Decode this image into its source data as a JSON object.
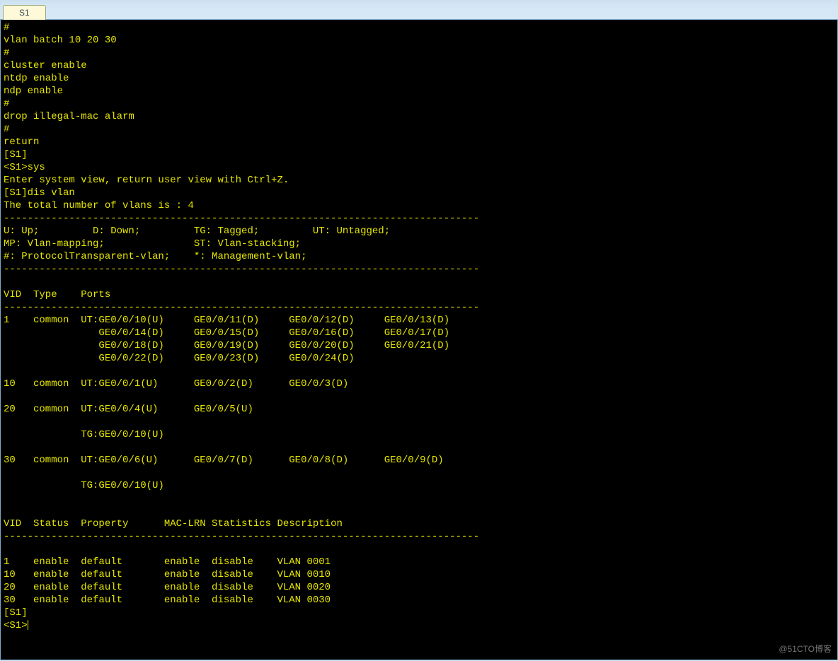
{
  "tab": {
    "label": "S1"
  },
  "terminal": {
    "lines": [
      "#",
      "vlan batch 10 20 30",
      "#",
      "cluster enable",
      "ntdp enable",
      "ndp enable",
      "#",
      "drop illegal-mac alarm",
      "#",
      "return",
      "[S1]",
      "<S1>sys",
      "Enter system view, return user view with Ctrl+Z.",
      "[S1]dis vlan",
      "The total number of vlans is : 4",
      "--------------------------------------------------------------------------------",
      "U: Up;         D: Down;         TG: Tagged;         UT: Untagged;",
      "MP: Vlan-mapping;               ST: Vlan-stacking;",
      "#: ProtocolTransparent-vlan;    *: Management-vlan;",
      "--------------------------------------------------------------------------------",
      "",
      "VID  Type    Ports",
      "--------------------------------------------------------------------------------",
      "1    common  UT:GE0/0/10(U)     GE0/0/11(D)     GE0/0/12(D)     GE0/0/13(D)",
      "                GE0/0/14(D)     GE0/0/15(D)     GE0/0/16(D)     GE0/0/17(D)",
      "                GE0/0/18(D)     GE0/0/19(D)     GE0/0/20(D)     GE0/0/21(D)",
      "                GE0/0/22(D)     GE0/0/23(D)     GE0/0/24(D)",
      "",
      "10   common  UT:GE0/0/1(U)      GE0/0/2(D)      GE0/0/3(D)",
      "",
      "20   common  UT:GE0/0/4(U)      GE0/0/5(U)",
      "",
      "             TG:GE0/0/10(U)",
      "",
      "30   common  UT:GE0/0/6(U)      GE0/0/7(D)      GE0/0/8(D)      GE0/0/9(D)",
      "",
      "             TG:GE0/0/10(U)",
      "",
      "",
      "VID  Status  Property      MAC-LRN Statistics Description",
      "--------------------------------------------------------------------------------",
      "",
      "1    enable  default       enable  disable    VLAN 0001",
      "10   enable  default       enable  disable    VLAN 0010",
      "20   enable  default       enable  disable    VLAN 0020",
      "30   enable  default       enable  disable    VLAN 0030",
      "[S1]"
    ],
    "prompt": "<S1>"
  },
  "watermark": "@51CTO博客"
}
